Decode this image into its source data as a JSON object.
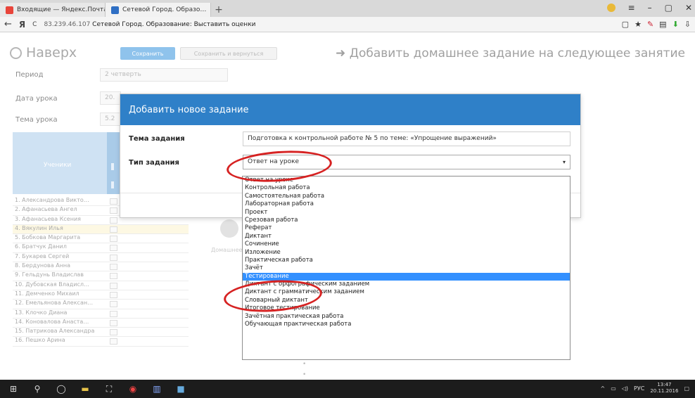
{
  "browser": {
    "tabs": [
      {
        "title": "Входящие — Яндекс.Почта",
        "favicon_color": "#e8443a"
      },
      {
        "title": "Сетевой Город. Образо…",
        "favicon_color": "#2f6fc4"
      }
    ],
    "new_tab": "+",
    "address": {
      "back": "←",
      "yandex": "Я",
      "reload": "C",
      "host": "83.239.46.107",
      "page_title": "Сетевой Город. Образование: Выставить оценки"
    },
    "window_controls": [
      "≡",
      "–",
      "▢",
      "✕"
    ],
    "tools": [
      "▢",
      "★",
      "✎",
      "▤",
      "⬇",
      "⇩"
    ]
  },
  "app": {
    "up_label": "Наверх",
    "save_button": "Сохранить",
    "save_return_button": "Сохранить и вернуться",
    "add_homework": "Добавить домашнее задание на следующее занятие"
  },
  "lesson_form": {
    "period_label": "Период",
    "period_value": "2 четверть",
    "date_label": "Дата урока",
    "date_value": "20.",
    "topic_label": "Тема урока",
    "topic_value": "5.2",
    "students_header": "Ученики",
    "add_label": "Домашнее"
  },
  "students": [
    "1. Александрова Викто…",
    "2. Афанасьева Ангел",
    "3. Афанасьева Ксения",
    "4. Вякулин Илья",
    "5. Бобкова Маргарита",
    "6. Братчук Данил",
    "7. Букарев Сергей",
    "8. Бердунова Анна",
    "9. Гельдунь Владислав",
    "10. Дубовская Владисл…",
    "11. Демченко Михаил",
    "12. Емельянова Алексан…",
    "13. Клочко Диана",
    "14. Коновалова Анаста…",
    "15. Патрикова Александра",
    "16. Пешко Арина"
  ],
  "modal": {
    "title": "Добавить новое задание",
    "task_topic_label": "Тема задания",
    "task_topic_value": "Подготовка к контрольной работе № 5 по теме: «Упрощение выражений»",
    "task_type_label": "Тип задания",
    "task_type_value": "Ответ на уроке",
    "caret": "▾"
  },
  "task_types": [
    "Ответ на уроке",
    "Контрольная работа",
    "Самостоятельная работа",
    "Лабораторная работа",
    "Проект",
    "Срезовая работа",
    "Реферат",
    "Диктант",
    "Сочинение",
    "Изложение",
    "Практическая работа",
    "Зачёт",
    "Тестирование",
    "Диктант с орфографическим заданием",
    "Диктант с грамматическим заданием",
    "Словарный диктант",
    "Итоговое тестирование",
    "Зачётная практическая работа",
    "Обучающая практическая работа"
  ],
  "selected_task_type": "Тестирование",
  "taskbar": {
    "tray_lang": "РУС",
    "time": "13:47",
    "date": "20.11.2016"
  },
  "colors": {
    "modal_header": "#2f80c8",
    "selection": "#3390ff",
    "annotation_ring": "#d62222",
    "taskbar": "#1c1c1c"
  }
}
